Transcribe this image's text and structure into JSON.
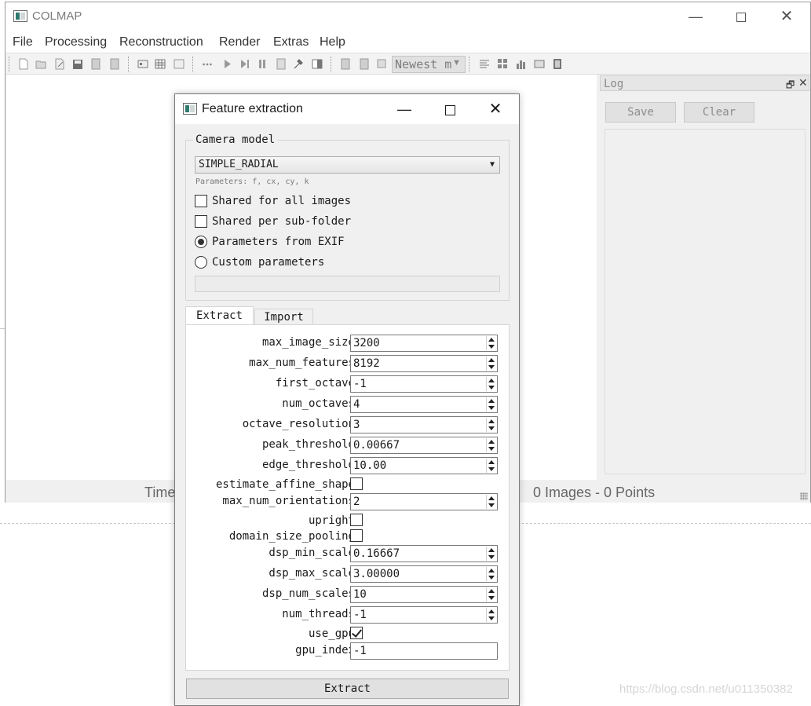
{
  "main_window": {
    "title": "COLMAP",
    "controls": {
      "minimize": "—",
      "close": "✕"
    },
    "menu": [
      "File",
      "Processing",
      "Reconstruction",
      "Render",
      "Extras",
      "Help"
    ],
    "toolbar": {
      "icons": [
        "new-project-icon",
        "open-project-icon",
        "edit-project-icon",
        "save-project-icon",
        "import-icon",
        "export-icon",
        "feature-extraction-icon",
        "feature-matching-icon",
        "database-icon",
        "reconstruction-start-icon",
        "reconstruction-step-icon",
        "reconstruction-pause-icon",
        "reconstruction-reset-icon",
        "normalize-icon",
        "bundle-adjustment-icon",
        "render-options-icon",
        "camera-icon",
        "points-icon",
        "grab-image-icon"
      ],
      "render_select": "Newest m"
    },
    "log": {
      "title": "Log",
      "float_glyph": "🗗",
      "close_glyph": "✕",
      "save_label": "Save",
      "clear_label": "Clear"
    },
    "status": {
      "left_text": "Time",
      "right_text": "0 Images - 0 Points"
    }
  },
  "dialog": {
    "title": "Feature extraction",
    "controls": {
      "minimize": "—",
      "close": "✕"
    },
    "camera_model": {
      "group_label": "Camera model",
      "selected": "SIMPLE_RADIAL",
      "params_hint": "Parameters: f, cx, cy, k",
      "options": [
        {
          "label": "Shared for all images",
          "kind": "checkbox",
          "checked": false
        },
        {
          "label": "Shared per sub-folder",
          "kind": "checkbox",
          "checked": false
        },
        {
          "label": "Parameters from EXIF",
          "kind": "radio",
          "checked": true
        },
        {
          "label": "Custom parameters",
          "kind": "radio",
          "checked": false
        }
      ],
      "custom_params_value": ""
    },
    "tabs": [
      "Extract",
      "Import"
    ],
    "params": {
      "max_image_size": {
        "label": "max_image_size",
        "value": "3200"
      },
      "max_num_features": {
        "label": "max_num_features",
        "value": "8192"
      },
      "first_octave": {
        "label": "first_octave",
        "value": "-1"
      },
      "num_octaves": {
        "label": "num_octaves",
        "value": "4"
      },
      "octave_resolution": {
        "label": "octave_resolution",
        "value": "3"
      },
      "peak_threshold": {
        "label": "peak_threshold",
        "value": "0.00667"
      },
      "edge_threshold": {
        "label": "edge_threshold",
        "value": "10.00"
      },
      "estimate_affine_shape": {
        "label": "estimate_affine_shape",
        "checked": false
      },
      "max_num_orientations": {
        "label": "max_num_orientations",
        "value": "2"
      },
      "upright": {
        "label": "upright",
        "checked": false
      },
      "domain_size_pooling": {
        "label": "domain_size_pooling",
        "checked": false
      },
      "dsp_min_scale": {
        "label": "dsp_min_scale",
        "value": "0.16667"
      },
      "dsp_max_scale": {
        "label": "dsp_max_scale",
        "value": "3.00000"
      },
      "dsp_num_scales": {
        "label": "dsp_num_scales",
        "value": "10"
      },
      "num_threads": {
        "label": "num_threads",
        "value": "-1"
      },
      "use_gpu": {
        "label": "use_gpu",
        "checked": true
      },
      "gpu_index": {
        "label": "gpu_index",
        "value": "-1"
      }
    },
    "extract_button": "Extract"
  },
  "watermark": "https://blog.csdn.net/u011350382"
}
